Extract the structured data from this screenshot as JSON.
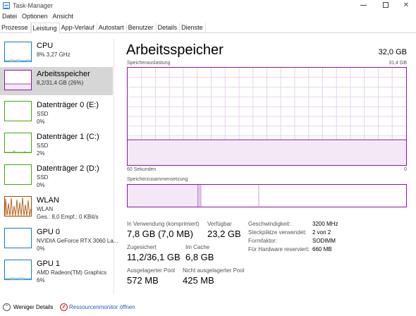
{
  "window": {
    "title": "Task-Manager"
  },
  "menu": [
    "Datei",
    "Optionen",
    "Ansicht"
  ],
  "tabs": [
    "Prozesse",
    "Leistung",
    "App-Verlauf",
    "Autostart",
    "Benutzer",
    "Details",
    "Dienste"
  ],
  "active_tab": "Leistung",
  "sidebar": {
    "items": [
      {
        "name": "CPU",
        "line1": "8% 3,27 GHz",
        "line2": "",
        "color": "#117dbb",
        "selected": false
      },
      {
        "name": "Arbeitsspeicher",
        "line1": "8,2/31,4 GB (26%)",
        "line2": "",
        "color": "#8b12ae",
        "selected": true
      },
      {
        "name": "Datenträger 0 (E:)",
        "line1": "SSD",
        "line2": "0%",
        "color": "#4da60c",
        "selected": false
      },
      {
        "name": "Datenträger 1 (C:)",
        "line1": "SSD",
        "line2": "2%",
        "color": "#4da60c",
        "selected": false
      },
      {
        "name": "Datenträger 2 (D:)",
        "line1": "SSD",
        "line2": "0%",
        "color": "#4da60c",
        "selected": false
      },
      {
        "name": "WLAN",
        "line1": "WLAN",
        "line2": "Ges.: 8,0  Empf.: 0 KBit/s",
        "color": "#a74f01",
        "selected": false
      },
      {
        "name": "GPU 0",
        "line1": "NVIDIA GeForce RTX 3060 La...",
        "line2": "0%",
        "color": "#117dbb",
        "selected": false
      },
      {
        "name": "GPU 1",
        "line1": "AMD Radeon(TM) Graphics",
        "line2": "6%",
        "color": "#117dbb",
        "selected": false
      }
    ]
  },
  "main": {
    "title": "Arbeitsspeicher",
    "total": "32,0 GB",
    "usage_caption": "Speicherauslastung",
    "usage_max": "31,4 GB",
    "usage_fraction": 0.26,
    "axis_left": "60 Sekunden",
    "axis_right": "0",
    "composition_caption": "Speicherzusammensetzung",
    "stats": {
      "in_use_label": "In Verwendung (komprimiert)",
      "in_use_value": "7,8 GB (7,0 MB)",
      "available_label": "Verfügbar",
      "available_value": "23,2 GB",
      "committed_label": "Zugesichert",
      "committed_value": "11,2/36,1 GB",
      "cached_label": "Im Cache",
      "cached_value": "6,8 GB",
      "paged_label": "Ausgelagerter Pool",
      "paged_value": "572 MB",
      "nonpaged_label": "Nicht ausgelagerter Pool",
      "nonpaged_value": "425 MB"
    },
    "details": [
      {
        "label": "Geschwindigkeit:",
        "value": "3200 MHz"
      },
      {
        "label": "Steckplätze verwendet:",
        "value": "2 von 2"
      },
      {
        "label": "Formfaktor:",
        "value": "SODIMM"
      },
      {
        "label": "Für Hardware reserviert:",
        "value": "660 MB"
      }
    ]
  },
  "footer": {
    "fewer_details": "Weniger Details",
    "resource_monitor": "Ressourcenmonitor öffnen"
  },
  "colors": {
    "memory": "#8b12ae",
    "memory_fill": "#f4e8f7",
    "grid": "#e6d2ee",
    "selected_bg": "#d6d6d6"
  }
}
